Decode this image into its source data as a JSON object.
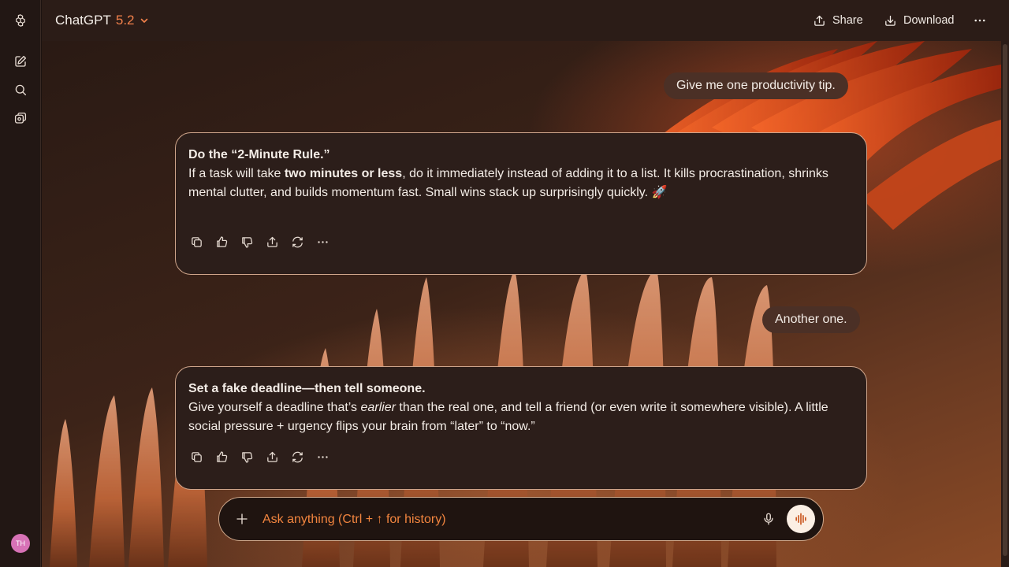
{
  "header": {
    "model_name": "ChatGPT",
    "model_version": "5.2",
    "share_label": "Share",
    "download_label": "Download"
  },
  "sidebar": {
    "avatar_initials": "TH"
  },
  "messages": [
    {
      "role": "user",
      "text": "Give me one productivity tip."
    },
    {
      "role": "assistant",
      "title": "Do the “2-Minute Rule.”",
      "pre": "If a task will take ",
      "bold": "two minutes or less",
      "post": ", do it immediately instead of adding it to a list. It kills procrastination, shrinks mental clutter, and builds momentum fast. Small wins stack up surprisingly quickly. 🚀"
    },
    {
      "role": "user",
      "text": "Another one."
    },
    {
      "role": "assistant",
      "title": "Set a fake deadline—then tell someone.",
      "pre": "Give yourself a deadline that’s ",
      "italic": "earlier",
      "post": " than the real one, and tell a friend (or even write it somewhere visible). A little social pressure + urgency flips your brain from “later” to “now.”"
    }
  ],
  "composer": {
    "placeholder": "Ask anything (Ctrl + ↑ for history)"
  },
  "colors": {
    "accent": "#f2814b",
    "user_bubble": "#4b3026",
    "assistant_card": "#2c1e1a",
    "card_border": "#cfa58b"
  }
}
